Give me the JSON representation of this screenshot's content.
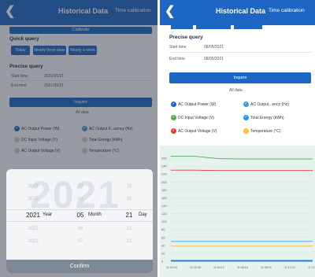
{
  "colors": {
    "header": "#1e66c4",
    "accent": "#1e66c4"
  },
  "left": {
    "header": {
      "back_icon": "chevron-left-icon",
      "title": "Historical Data",
      "time_calibration": "Time calibration"
    },
    "top_button": "Calibrate",
    "quick_query": {
      "label": "Quick query",
      "buttons": [
        "Today",
        "Nearly three days",
        "Nearly a week"
      ]
    },
    "precise_query": {
      "label": "Precise query",
      "start_label": "Start time",
      "start_value": "2021/05/21",
      "end_label": "End time",
      "end_value": "2021/05/21"
    },
    "inquire_label": "Inquire",
    "all_data": "All data",
    "legend": [
      "AC Output Power (W)",
      "AC Output F...uency (Hz)",
      "DC Input Voltage (V)",
      "Total Energy (kWh)",
      "AC Output Voltage (V)",
      "Temperature (°C)"
    ],
    "picker": {
      "year_watermark": "2021",
      "years_before": [
        "2019",
        "2020"
      ],
      "selected_year": "2021",
      "years_after": [
        "2022",
        "2023"
      ],
      "year_unit": "Year",
      "months_before": [
        "03",
        "04"
      ],
      "selected_month": "05",
      "months_after": [
        "06",
        "07"
      ],
      "month_unit": "Month",
      "days_before": [
        "19",
        "20"
      ],
      "selected_day": "21",
      "days_after": [
        "22",
        "23"
      ],
      "day_unit": "Day",
      "confirm_label": "Confirm"
    }
  },
  "right": {
    "header": {
      "back_icon": "chevron-left-icon",
      "title": "Historical Data",
      "time_calibration": "Time calibration"
    },
    "precise_query": {
      "label": "Precise query",
      "start_label": "Start time",
      "start_value": "08/05/2021",
      "end_label": "End time",
      "end_value": "08/05/2021"
    },
    "inquire_label": "Inquire",
    "all_data": "All data",
    "legend": [
      {
        "label": "AC Output Power  (W)",
        "color": "#1e66c4",
        "checked": true
      },
      {
        "label": "AC Output...ency  (Hz)",
        "color": "#3a9be0",
        "checked": true
      },
      {
        "label": "DC Input Voltage  (V)",
        "color": "#4caf50",
        "checked": true
      },
      {
        "label": "Total Energy  (kWh)",
        "color": "#2196f3",
        "checked": true
      },
      {
        "label": "AC Output Voltage  (V)",
        "color": "#e53935",
        "checked": true
      },
      {
        "label": "Temperature  (°C)",
        "color": "#fbc02d",
        "checked": true
      }
    ]
  },
  "chart_data": {
    "type": "line",
    "title": "",
    "xlabel": "",
    "ylabel": "",
    "y_ticks": [
      0,
      20,
      40,
      60,
      80,
      100,
      120,
      140,
      160,
      180,
      200,
      220,
      240,
      260
    ],
    "x_ticks": [
      "11:00:04",
      "11:02:08",
      "11:04:12",
      "11:06:16",
      "11:08:20",
      "11:10:24",
      "11:12:28"
    ],
    "ylim": [
      0,
      270
    ],
    "series": [
      {
        "color": "#4caf50",
        "values": [
          265,
          265,
          259,
          258,
          258,
          258,
          258
        ]
      },
      {
        "color": "#e53935",
        "values": [
          230,
          230,
          229,
          229,
          229,
          229,
          229
        ]
      },
      {
        "color": "#3a9be0",
        "values": [
          50,
          50,
          50,
          50,
          50,
          50,
          50
        ]
      },
      {
        "color": "#fbc02d",
        "values": [
          38,
          38,
          38,
          38,
          38,
          38,
          38
        ]
      },
      {
        "color": "#1e66c4",
        "values": [
          2,
          2,
          2,
          2,
          2,
          2,
          2
        ]
      },
      {
        "color": "#2196f3",
        "values": [
          0,
          0,
          0,
          0,
          0,
          0,
          0
        ]
      }
    ]
  }
}
